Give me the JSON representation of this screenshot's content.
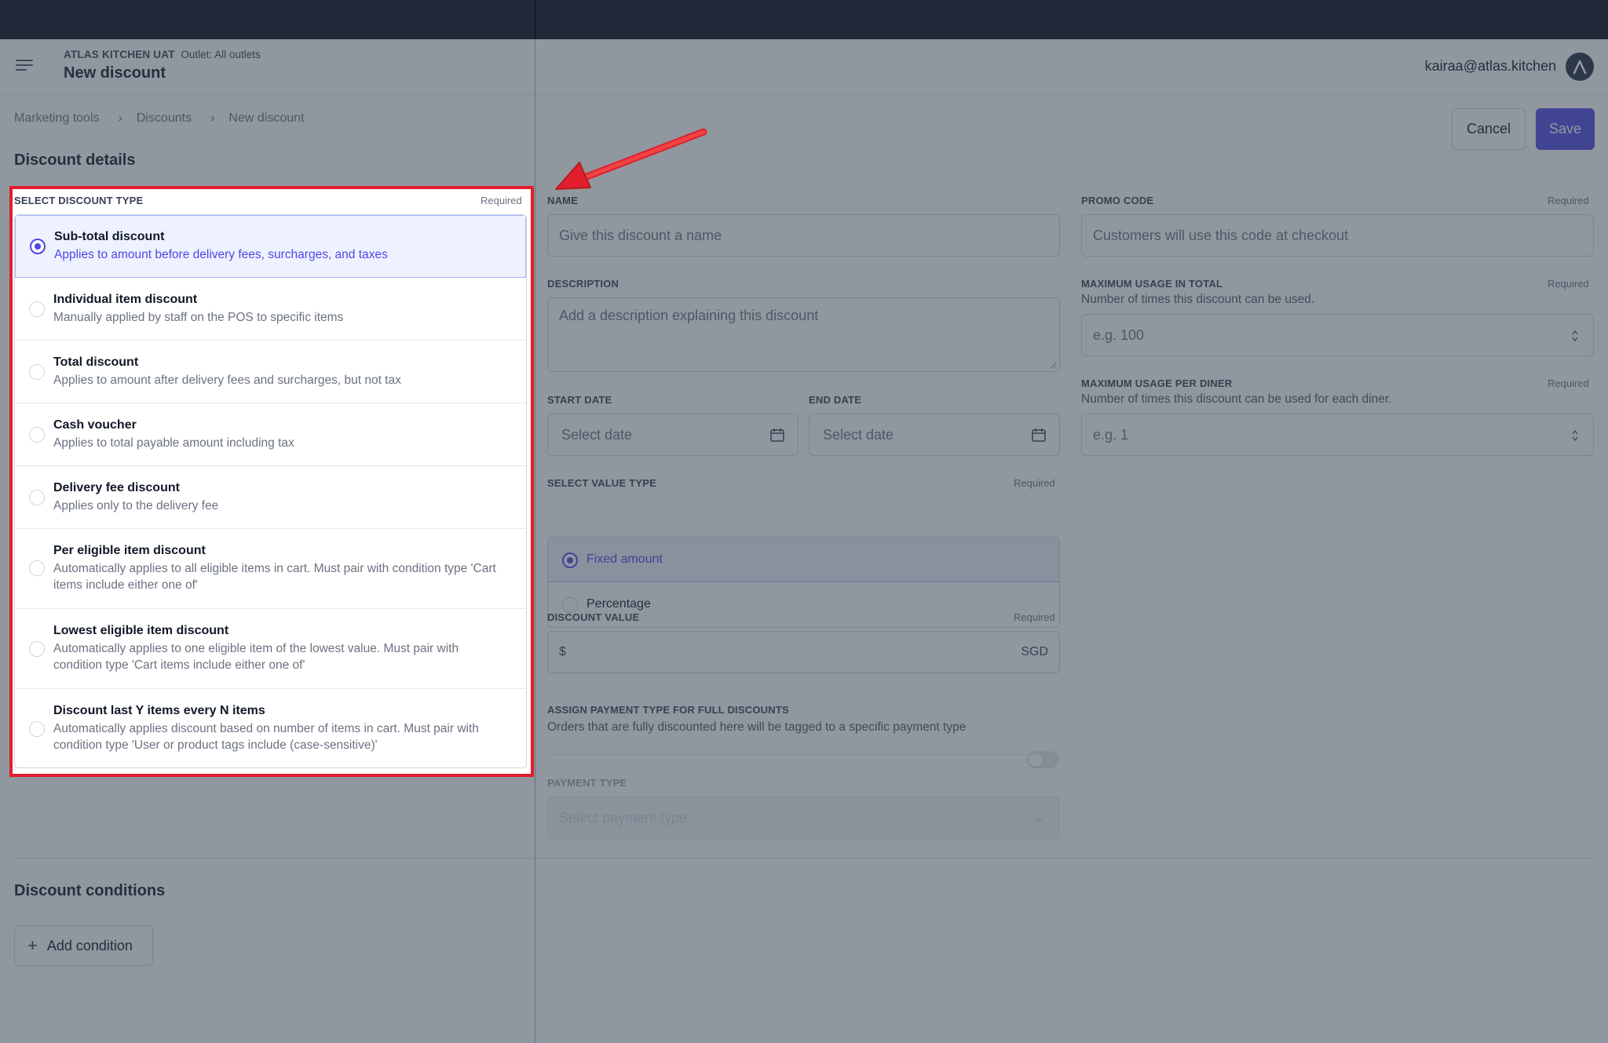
{
  "header": {
    "org_name": "ATLAS KITCHEN UAT",
    "outlet_text": "Outlet: All outlets",
    "page_title": "New discount",
    "user_email": "kairaa@atlas.kitchen"
  },
  "breadcrumb": [
    "Marketing tools",
    "Discounts",
    "New discount"
  ],
  "actions": {
    "cancel": "Cancel",
    "save": "Save"
  },
  "details": {
    "section_title": "Discount details",
    "discount_type": {
      "label": "SELECT DISCOUNT TYPE",
      "required": "Required",
      "selected_index": 0,
      "options": [
        {
          "title": "Sub-total discount",
          "desc": "Applies to amount before delivery fees, surcharges, and taxes"
        },
        {
          "title": "Individual item discount",
          "desc": "Manually applied by staff on the POS to specific items"
        },
        {
          "title": "Total discount",
          "desc": "Applies to amount after delivery fees and surcharges, but not tax"
        },
        {
          "title": "Cash voucher",
          "desc": "Applies to total payable amount including tax"
        },
        {
          "title": "Delivery fee discount",
          "desc": "Applies only to the delivery fee"
        },
        {
          "title": "Per eligible item discount",
          "desc": "Automatically applies to all eligible items in cart. Must pair with condition type 'Cart items include either one of'"
        },
        {
          "title": "Lowest eligible item discount",
          "desc": "Automatically applies to one eligible item of the lowest value. Must pair with condition type 'Cart items include either one of'"
        },
        {
          "title": "Discount last Y items every N items",
          "desc": "Automatically applies discount based on number of items in cart. Must pair with condition type 'User or product tags include (case-sensitive)'"
        }
      ]
    },
    "name": {
      "label": "NAME",
      "placeholder": "Give this discount a name"
    },
    "promo_code": {
      "label": "PROMO CODE",
      "required": "Required",
      "placeholder": "Customers will use this code at checkout"
    },
    "description": {
      "label": "DESCRIPTION",
      "placeholder": "Add a description explaining this discount"
    },
    "max_usage_total": {
      "label": "MAXIMUM USAGE IN TOTAL",
      "required": "Required",
      "help": "Number of times this discount can be used.",
      "placeholder": "e.g. 100"
    },
    "max_usage_diner": {
      "label": "MAXIMUM USAGE PER DINER",
      "required": "Required",
      "help": "Number of times this discount can be used for each diner.",
      "placeholder": "e.g. 1"
    },
    "start_date": {
      "label": "START DATE",
      "placeholder": "Select date"
    },
    "end_date": {
      "label": "END DATE",
      "placeholder": "Select date"
    },
    "value_type": {
      "label": "SELECT VALUE TYPE",
      "required": "Required",
      "options": [
        "Fixed amount",
        "Percentage"
      ],
      "selected_index": 0
    },
    "discount_value": {
      "label": "DISCOUNT VALUE",
      "required": "Required",
      "prefix": "$",
      "suffix": "SGD"
    },
    "payment_assign": {
      "label": "ASSIGN PAYMENT TYPE FOR FULL DISCOUNTS",
      "help": "Orders that are fully discounted here will be tagged to a specific payment type",
      "enabled": false
    },
    "payment_type": {
      "label": "PAYMENT TYPE",
      "placeholder": "Select payment type"
    }
  },
  "conditions": {
    "section_title": "Discount conditions",
    "add_button": "Add condition"
  },
  "colors": {
    "accent": "#4f46e5",
    "highlight": "#e11d2e",
    "topbar": "#1f2937"
  }
}
